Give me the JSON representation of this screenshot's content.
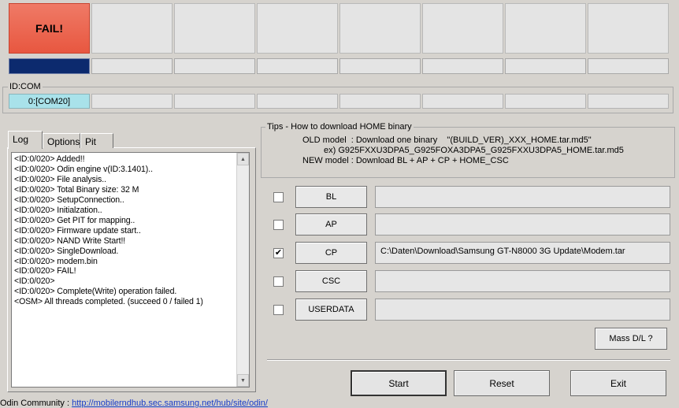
{
  "status": {
    "fail_label": "FAIL!"
  },
  "idcom": {
    "label": "ID:COM",
    "port": "0:[COM20]"
  },
  "tabs": [
    {
      "label": "Log"
    },
    {
      "label": "Options"
    },
    {
      "label": "Pit"
    }
  ],
  "log_lines": "<ID:0/020> Added!!\n<ID:0/020> Odin engine v(ID:3.1401)..\n<ID:0/020> File analysis..\n<ID:0/020> Total Binary size: 32 M\n<ID:0/020> SetupConnection..\n<ID:0/020> Initialzation..\n<ID:0/020> Get PIT for mapping..\n<ID:0/020> Firmware update start..\n<ID:0/020> NAND Write Start!!\n<ID:0/020> SingleDownload.\n<ID:0/020> modem.bin\n<ID:0/020> FAIL!\n<ID:0/020>\n<ID:0/020> Complete(Write) operation failed.\n<OSM> All threads completed. (succeed 0 / failed 1)",
  "tips": {
    "title": "Tips - How to download HOME binary",
    "line1": "OLD model  : Download one binary    \"(BUILD_VER)_XXX_HOME.tar.md5\"",
    "line2": "ex) G925FXXU3DPA5_G925FOXA3DPA5_G925FXXU3DPA5_HOME.tar.md5",
    "line3": "NEW model : Download BL + AP + CP + HOME_CSC"
  },
  "files": {
    "bl": {
      "label": "BL",
      "checked": false,
      "path": ""
    },
    "ap": {
      "label": "AP",
      "checked": false,
      "path": ""
    },
    "cp": {
      "label": "CP",
      "checked": true,
      "path": "C:\\Daten\\Download\\Samsung GT-N8000 3G Update\\Modem.tar"
    },
    "csc": {
      "label": "CSC",
      "checked": false,
      "path": ""
    },
    "userdata": {
      "label": "USERDATA",
      "checked": false,
      "path": ""
    }
  },
  "checkmark": "✔",
  "buttons": {
    "mass_dl": "Mass D/L ?",
    "start": "Start",
    "reset": "Reset",
    "exit": "Exit"
  },
  "footer": {
    "prefix": "Odin Community : ",
    "link": "http://mobilerndhub.sec.samsung.net/hub/site/odin/"
  },
  "colors": {
    "fail_bg": "#e85740",
    "progress_fill": "#0c2a6e",
    "com_active": "#a9e2ea"
  }
}
